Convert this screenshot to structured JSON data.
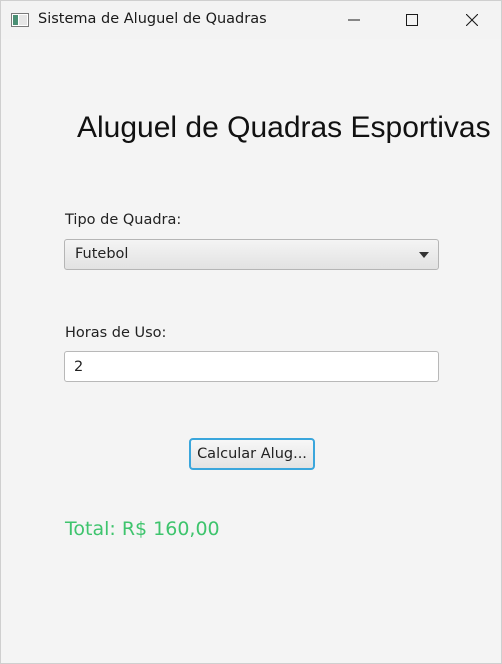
{
  "window": {
    "title": "Sistema de Aluguel de Quadras",
    "controls": {
      "minimize_icon": "minimize-icon",
      "maximize_icon": "maximize-icon",
      "close_icon": "close-icon"
    }
  },
  "main": {
    "heading": "Aluguel de Quadras Esportivas",
    "court_type": {
      "label": "Tipo de Quadra:",
      "selected": "Futebol"
    },
    "hours": {
      "label": "Horas de Uso:",
      "value": "2"
    },
    "calculate_button": "Calcular Alug...",
    "total": "Total: R$ 160,00"
  },
  "colors": {
    "accent_focus": "#3aa6dc",
    "total_text": "#3ec46d",
    "window_bg": "#f4f4f4"
  }
}
